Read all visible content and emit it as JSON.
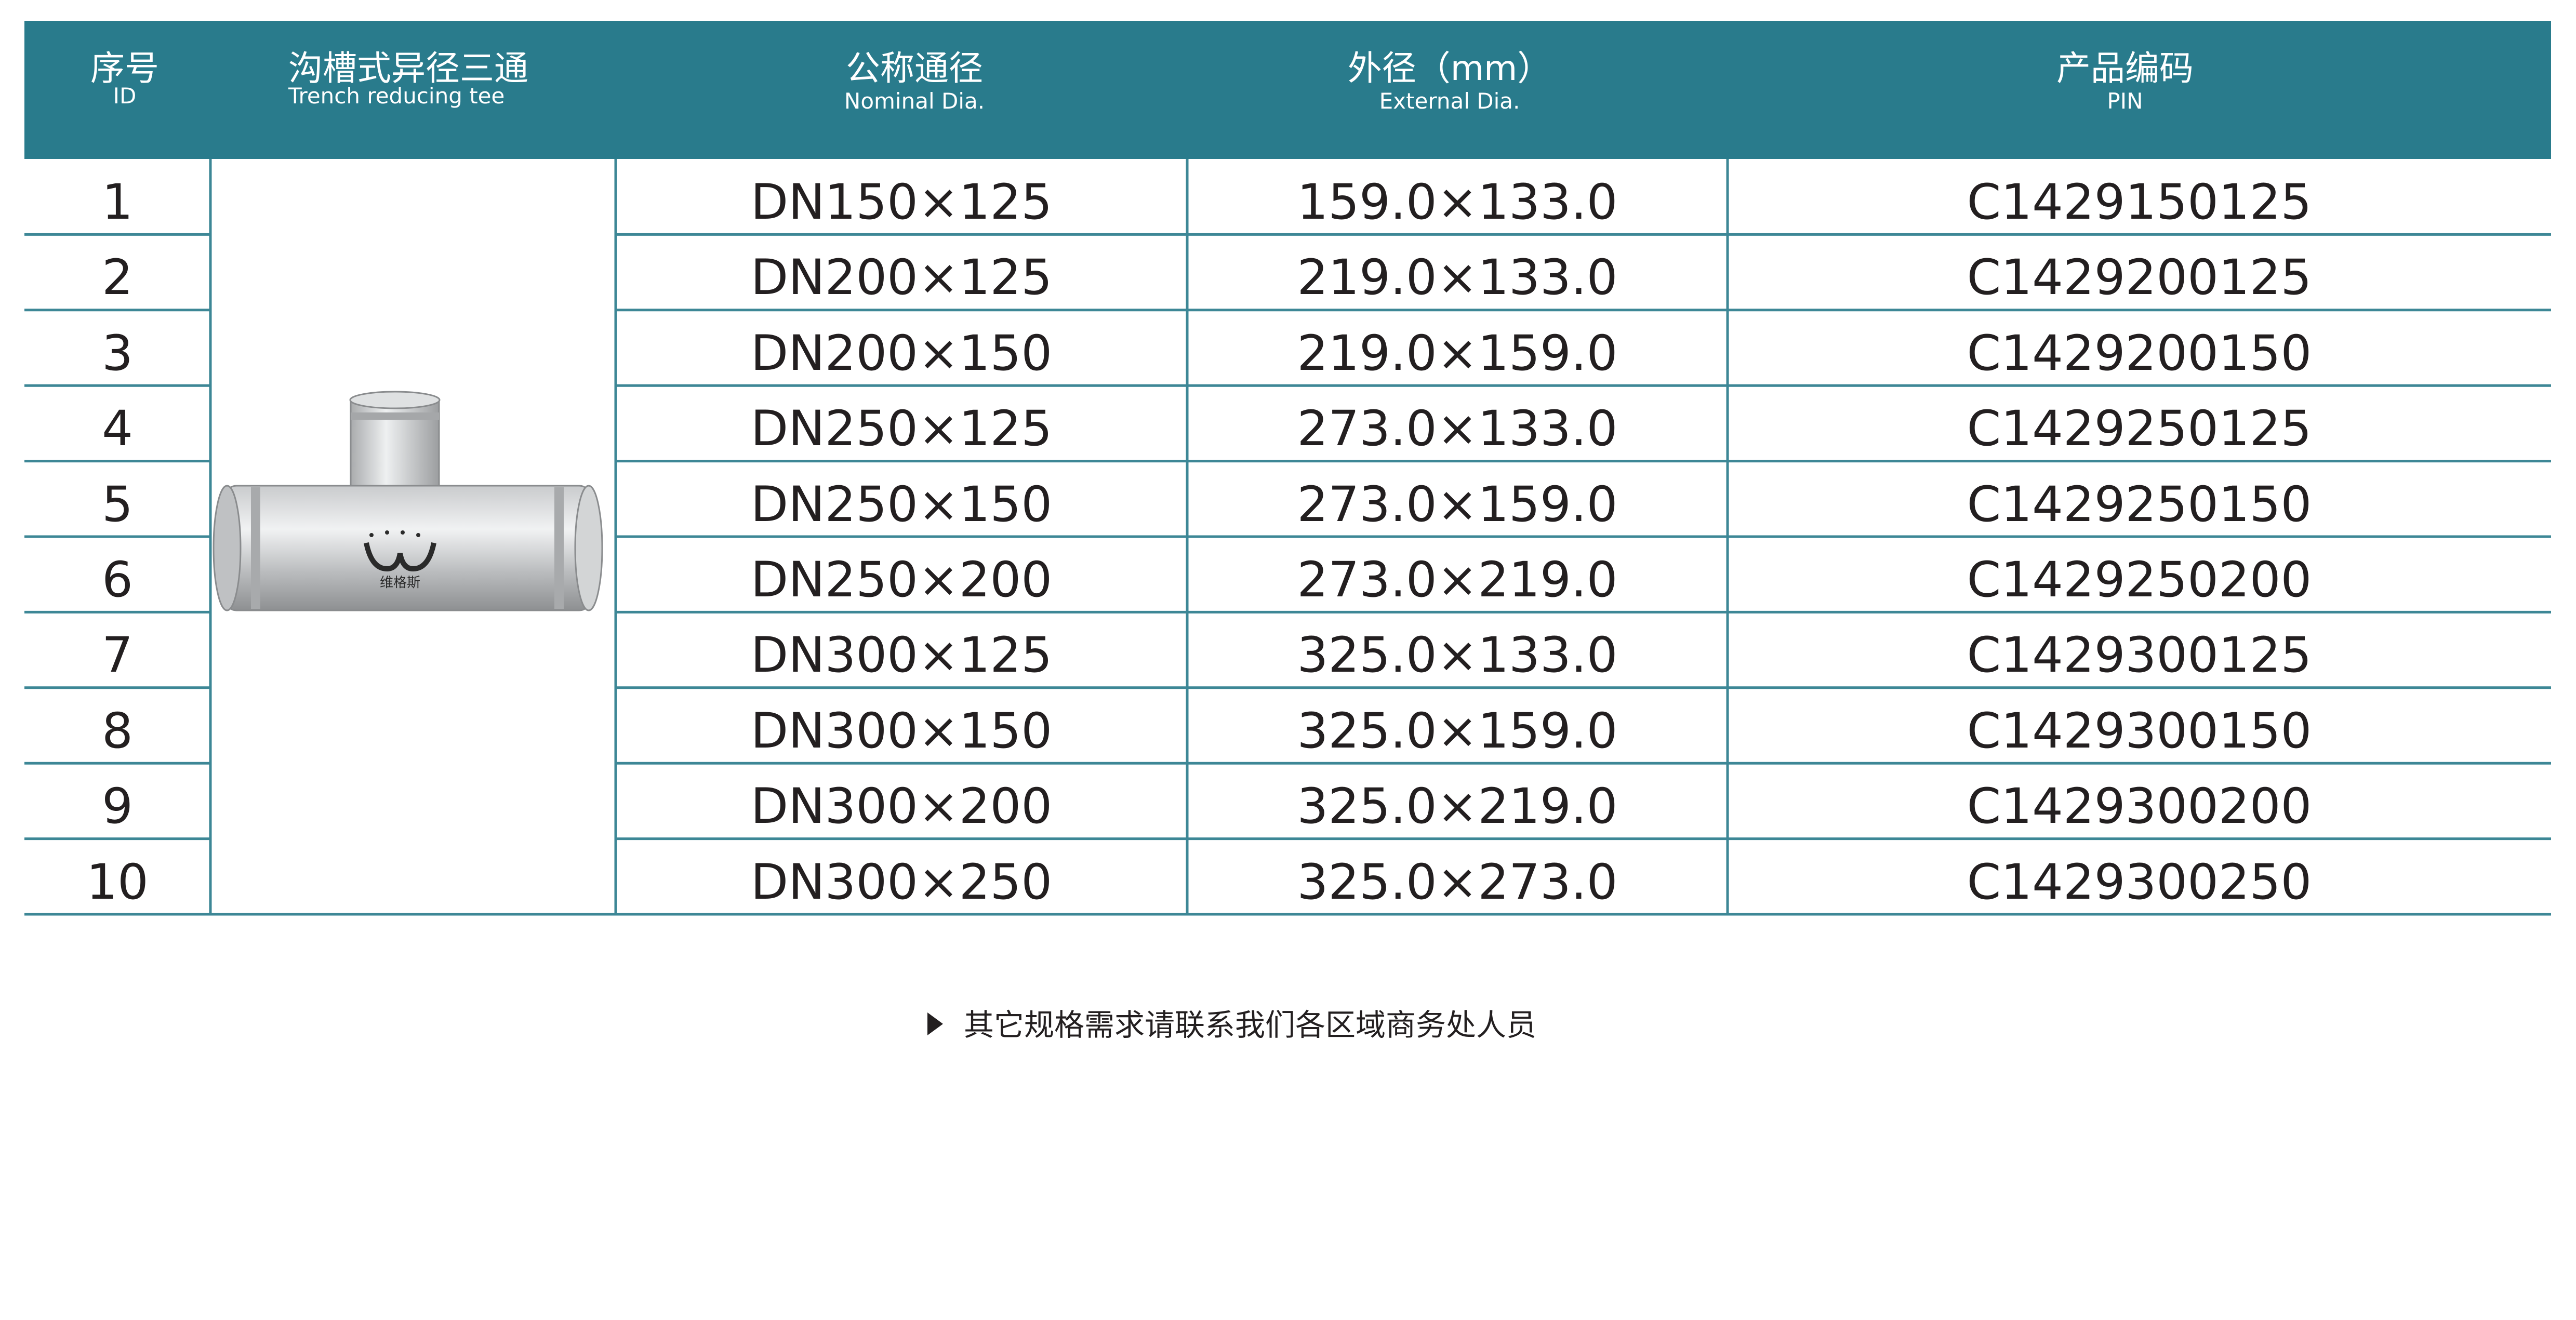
{
  "header": {
    "id": {
      "zh": "序号",
      "en": "ID"
    },
    "product": {
      "zh": "沟槽式异径三通",
      "en": "Trench reducing tee"
    },
    "nominal": {
      "zh": "公称通径",
      "en": "Nominal Dia."
    },
    "external": {
      "zh": "外径（mm）",
      "en": "External Dia."
    },
    "pin": {
      "zh": "产品编码",
      "en": "PIN"
    }
  },
  "rows": [
    {
      "id": "1",
      "nominal": "DN150×125",
      "external": "159.0×133.0",
      "pin": "C1429150125"
    },
    {
      "id": "2",
      "nominal": "DN200×125",
      "external": "219.0×133.0",
      "pin": "C1429200125"
    },
    {
      "id": "3",
      "nominal": "DN200×150",
      "external": "219.0×159.0",
      "pin": "C1429200150"
    },
    {
      "id": "4",
      "nominal": "DN250×125",
      "external": "273.0×133.0",
      "pin": "C1429250125"
    },
    {
      "id": "5",
      "nominal": "DN250×150",
      "external": "273.0×159.0",
      "pin": "C1429250150"
    },
    {
      "id": "6",
      "nominal": "DN250×200",
      "external": "273.0×219.0",
      "pin": "C1429250200"
    },
    {
      "id": "7",
      "nominal": "DN300×125",
      "external": "325.0×133.0",
      "pin": "C1429300125"
    },
    {
      "id": "8",
      "nominal": "DN300×150",
      "external": "325.0×159.0",
      "pin": "C1429300150"
    },
    {
      "id": "9",
      "nominal": "DN300×200",
      "external": "325.0×219.0",
      "pin": "C1429300200"
    },
    {
      "id": "10",
      "nominal": "DN300×250",
      "external": "325.0×273.0",
      "pin": "C1429300250"
    }
  ],
  "product_image": {
    "logo_text": "维格斯",
    "icon": "trench-reducing-tee-photo"
  },
  "note": "其它规格需求请联系我们各区域商务处人员",
  "colors": {
    "header": "#297b8c",
    "grid": "#3d8796",
    "text": "#231f20"
  }
}
